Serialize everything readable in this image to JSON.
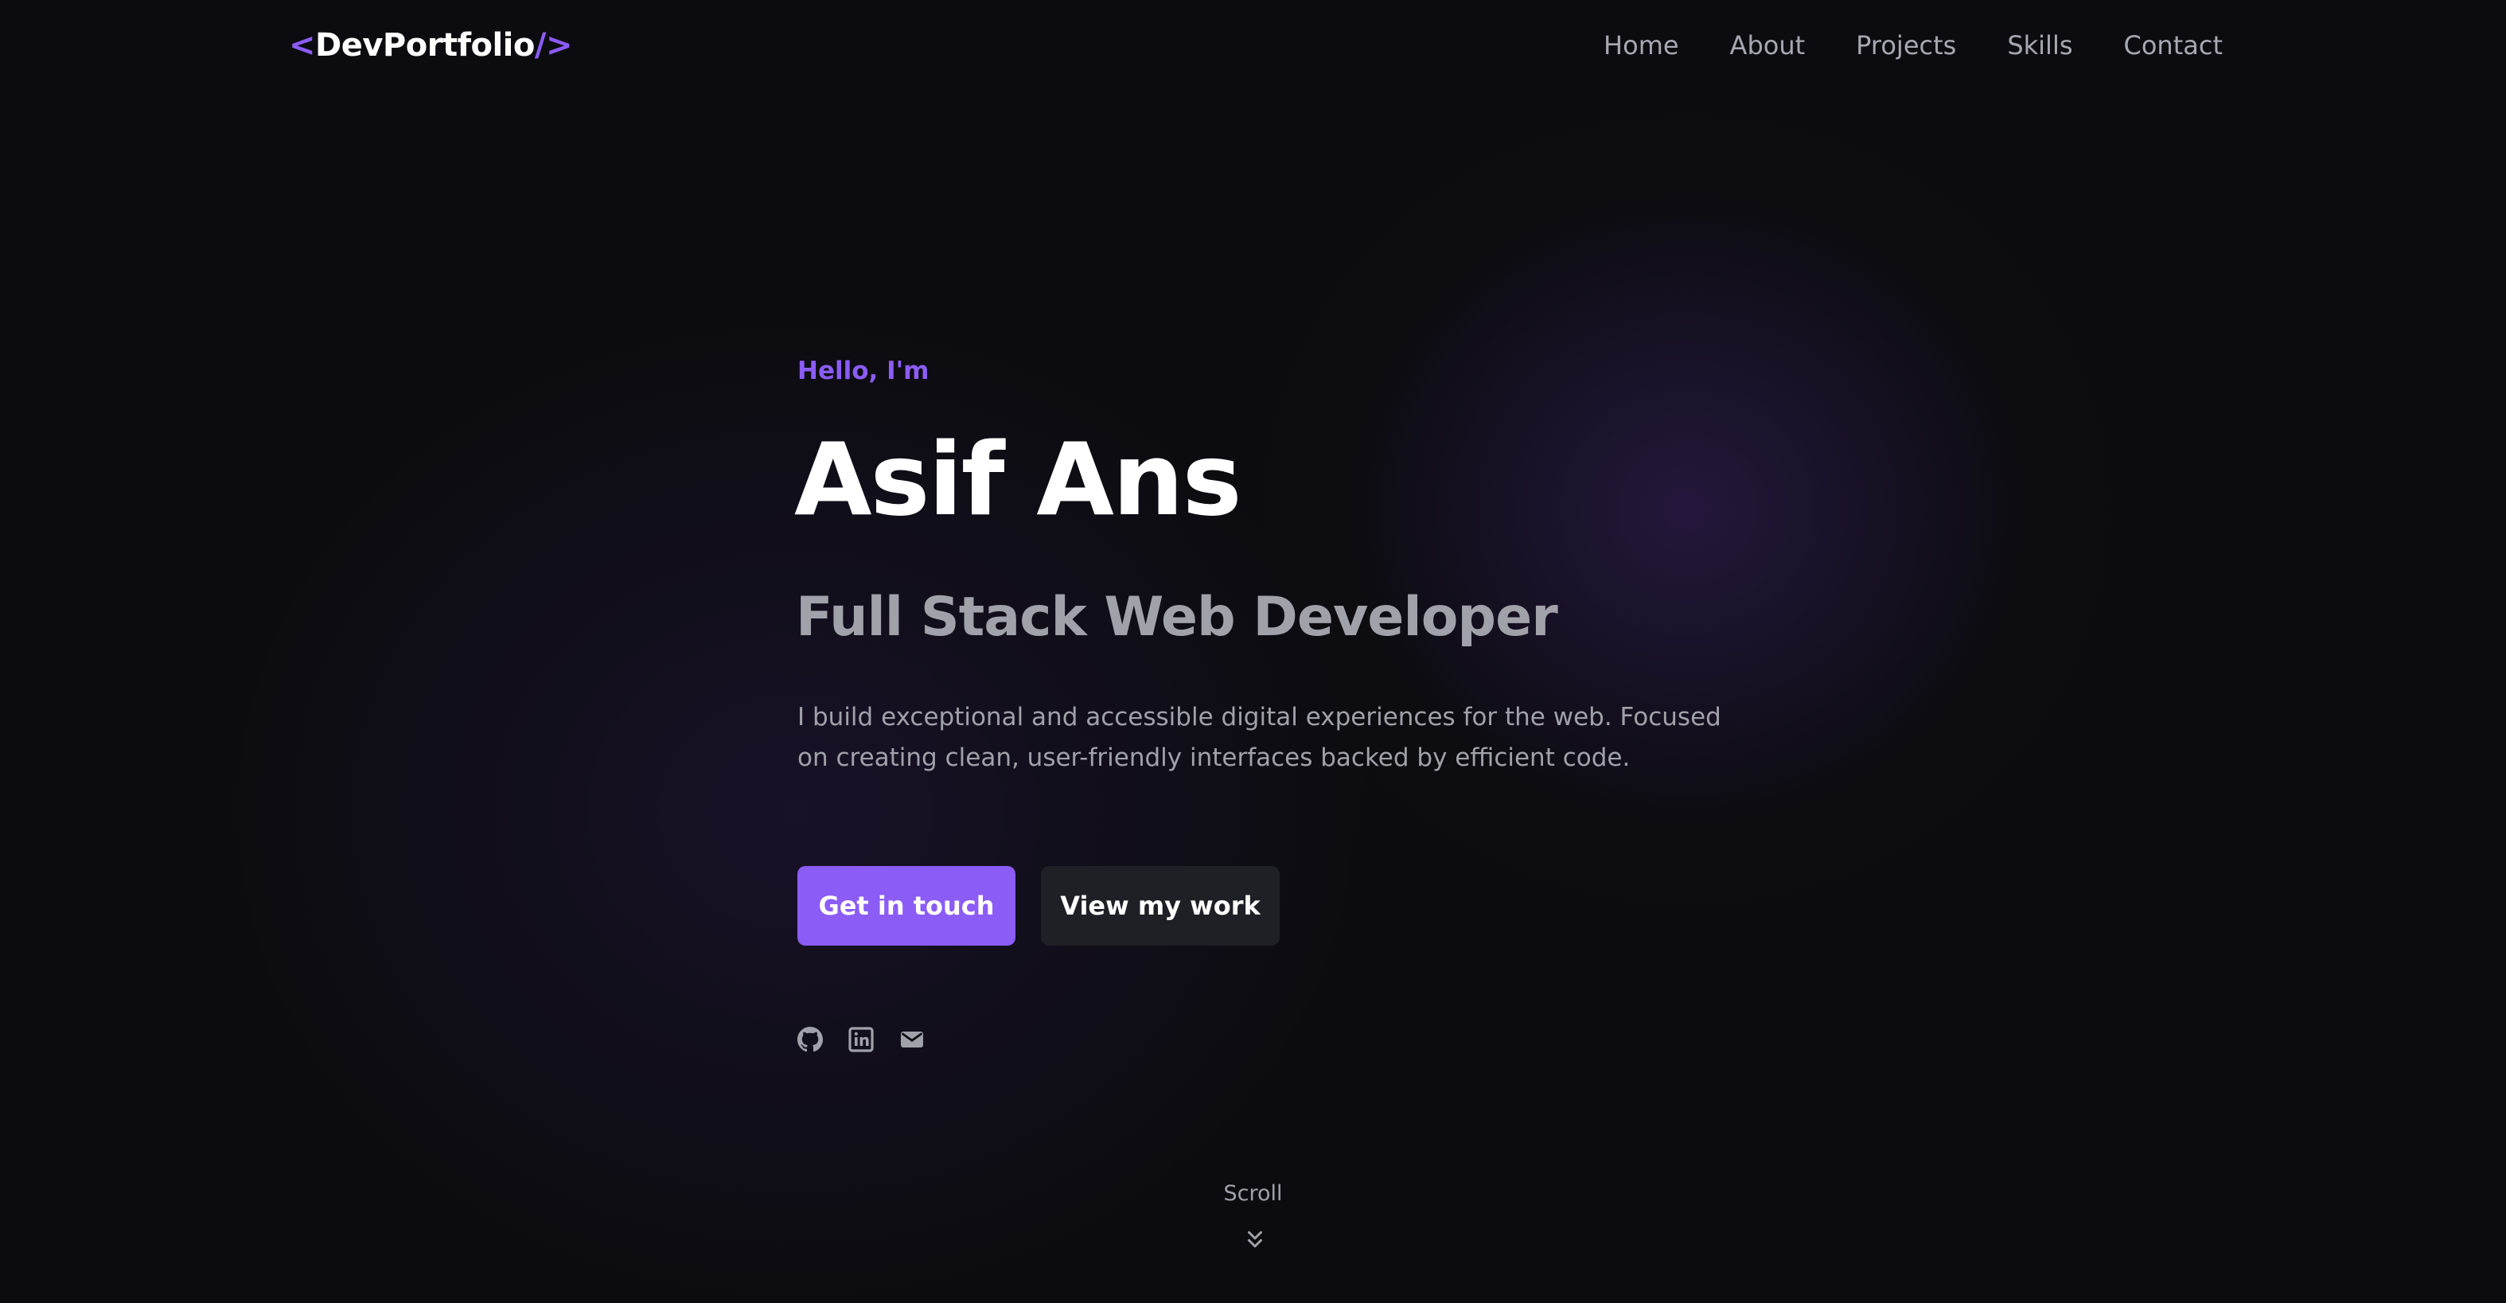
{
  "logo": {
    "open": "<",
    "name": "DevPortfolio",
    "close": "/>"
  },
  "nav": {
    "items": [
      {
        "label": "Home"
      },
      {
        "label": "About"
      },
      {
        "label": "Projects"
      },
      {
        "label": "Skills"
      },
      {
        "label": "Contact"
      }
    ]
  },
  "hero": {
    "greeting": "Hello, I'm",
    "name": "Asif Ans",
    "role": "Full Stack Web Developer",
    "bio": "I build exceptional and accessible digital experiences for the web. Focused on creating clean, user-friendly interfaces backed by efficient code.",
    "primary_button": "Get in touch",
    "secondary_button": "View my work"
  },
  "socials": [
    "github-icon",
    "linkedin-icon",
    "mail-icon"
  ],
  "scroll": {
    "label": "Scroll",
    "icon": "chevrons-down-icon"
  },
  "colors": {
    "background": "#0c0c10",
    "accent": "#8b5cf6",
    "muted_text": "#a1a1aa",
    "secondary_button": "#1f1f26"
  }
}
